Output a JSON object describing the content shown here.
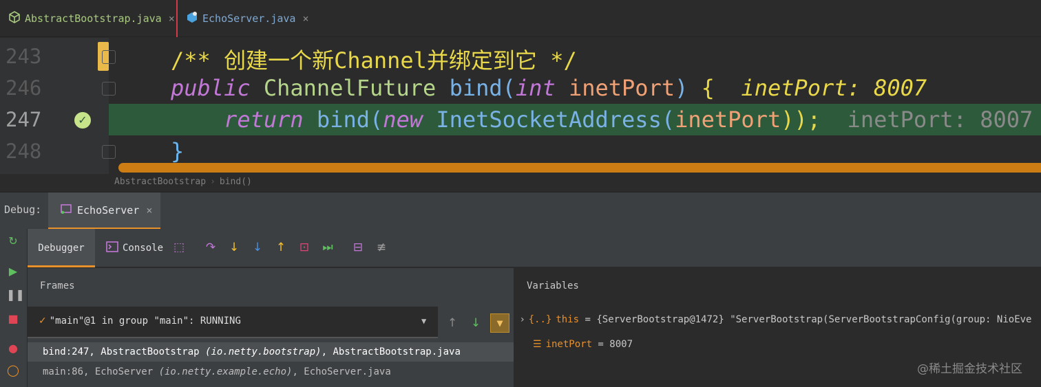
{
  "tabs": [
    {
      "label": "AbstractBootstrap.java",
      "close": "×"
    },
    {
      "label": "EchoServer.java",
      "close": "×"
    }
  ],
  "editor": {
    "lines": [
      {
        "num": "243",
        "comment": "/** 创建一个新Channel并绑定到它 */"
      },
      {
        "num": "246",
        "kw": "public",
        "type": "ChannelFuture",
        "fn": "bind",
        "open": "(",
        "ptype": "int",
        "param": "inetPort",
        "close": ")",
        "brace": "{",
        "hint": "inetPort: 8007"
      },
      {
        "num": "247",
        "kw": "return",
        "fn": "bind",
        "open": "(",
        "newkw": "new",
        "type": "InetSocketAddress",
        "open2": "(",
        "param": "inetPort",
        "close": "));",
        "hint": "inetPort: 8007"
      },
      {
        "num": "248",
        "brace": "}"
      }
    ]
  },
  "breadcrumb": {
    "class": "AbstractBootstrap",
    "method": "bind()",
    "sep": "›"
  },
  "debug": {
    "label": "Debug:",
    "session_tab": "EchoServer",
    "session_close": "×",
    "toolbar": {
      "debugger": "Debugger",
      "console": "Console"
    },
    "frames_title": "Frames",
    "variables_title": "Variables",
    "thread": "\"main\"@1 in group \"main\": RUNNING",
    "frames": [
      {
        "method": "bind:247, AbstractBootstrap ",
        "pkg": "(io.netty.bootstrap)",
        "file": ", AbstractBootstrap.java"
      },
      {
        "method": "main:86, EchoServer ",
        "pkg": "(io.netty.example.echo)",
        "file": ", EchoServer.java"
      }
    ],
    "variables": [
      {
        "name": "this",
        "value": " = {ServerBootstrap@1472} \"ServerBootstrap(ServerBootstrapConfig(group: NioEve"
      },
      {
        "name": "inetPort",
        "value": " = 8007"
      }
    ]
  },
  "watermark": "@稀土掘金技术社区",
  "colors": {
    "accent": "#e8902a",
    "current_line": "#2e5a3c",
    "comment": "#e8d84a",
    "keyword": "#c278d6"
  }
}
